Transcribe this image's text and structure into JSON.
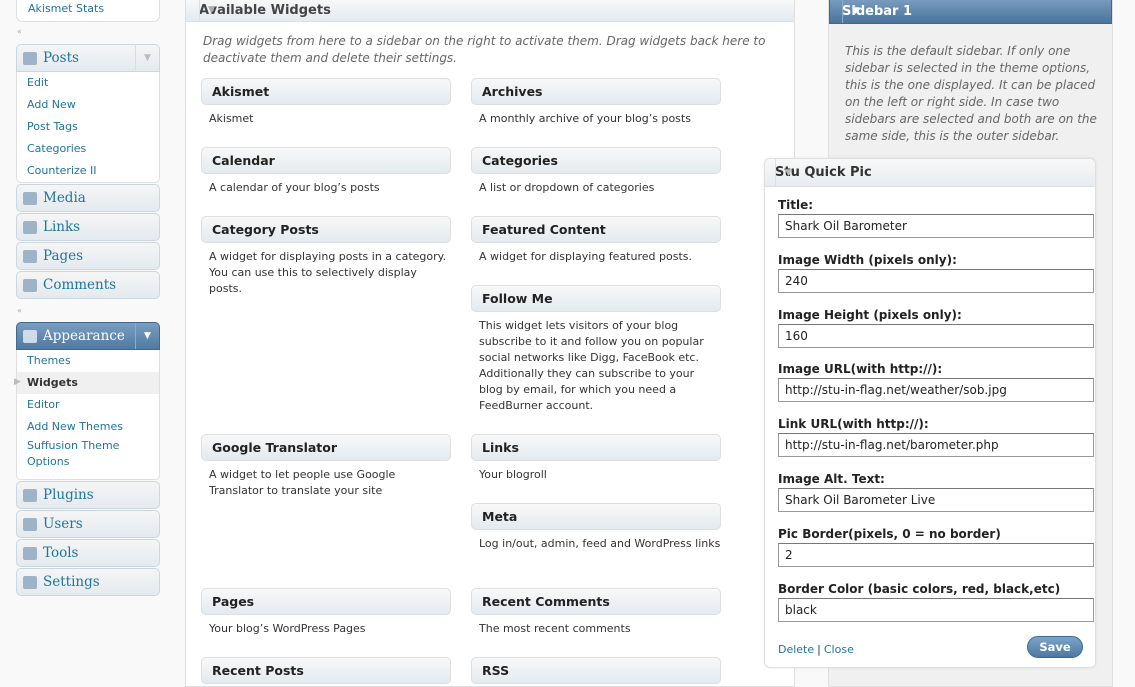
{
  "menu": {
    "akismet_stats": "Akismet Stats",
    "posts": {
      "label": "Posts",
      "items": [
        "Edit",
        "Add New",
        "Post Tags",
        "Categories",
        "Counterize II"
      ]
    },
    "media": "Media",
    "links": "Links",
    "pages": "Pages",
    "comments": "Comments",
    "appearance": {
      "label": "Appearance",
      "items": [
        "Themes",
        "Widgets",
        "Editor",
        "Add New Themes",
        "Suffusion Theme Options"
      ]
    },
    "plugins": "Plugins",
    "users": "Users",
    "tools": "Tools",
    "settings": "Settings"
  },
  "available": {
    "title": "Available Widgets",
    "description": "Drag widgets from here to a sidebar on the right to activate them. Drag widgets back here to deactivate them and delete their settings.",
    "widgets": [
      {
        "title": "Akismet",
        "desc": "Akismet"
      },
      {
        "title": "Archives",
        "desc": "A monthly archive of your blog’s posts"
      },
      {
        "title": "Calendar",
        "desc": "A calendar of your blog’s posts"
      },
      {
        "title": "Categories",
        "desc": "A list or dropdown of categories"
      },
      {
        "title": "Category Posts",
        "desc": "A widget for displaying posts in a category. You can use this to selectively display posts."
      },
      {
        "title": "Featured Content",
        "desc": "A widget for displaying featured posts."
      },
      {
        "title": "Follow Me",
        "desc": "This widget lets visitors of your blog subscribe to it and follow you on popular social networks like Digg, FaceBook etc. Additionally they can subscribe to your blog by email, for which you need a FeedBurner account."
      },
      {
        "title": "Google Translator",
        "desc": "A widget to let people use Google Translator to translate your site"
      },
      {
        "title": "Links",
        "desc": "Your blogroll"
      },
      {
        "title": "Meta",
        "desc": "Log in/out, admin, feed and WordPress links"
      },
      {
        "title": "Pages",
        "desc": "Your blog’s WordPress Pages"
      },
      {
        "title": "Recent Comments",
        "desc": "The most recent comments"
      },
      {
        "title": "Recent Posts",
        "desc": ""
      },
      {
        "title": "RSS",
        "desc": ""
      }
    ]
  },
  "sidebar": {
    "title": "Sidebar 1",
    "description": "This is the default sidebar. If only one sidebar is selected in the theme options, this is the one displayed. It can be placed on the left or right side. In case two sidebars are selected and both are on the same side, this is the outer sidebar."
  },
  "quickpic": {
    "title": "Stu Quick Pic",
    "fields": [
      {
        "label": "Title:",
        "value": "Shark Oil Barometer"
      },
      {
        "label": "Image Width (pixels only):",
        "value": "240"
      },
      {
        "label": "Image Height (pixels only):",
        "value": "160"
      },
      {
        "label": "Image URL(with http://):",
        "value": "http://stu-in-flag.net/weather/sob.jpg"
      },
      {
        "label": "Link URL(with http://):",
        "value": "http://stu-in-flag.net/barometer.php"
      },
      {
        "label": "Image Alt. Text:",
        "value": "Shark Oil Barometer Live"
      },
      {
        "label": "Pic Border(pixels, 0 = no border)",
        "value": "2"
      },
      {
        "label": "Border Color (basic colors, red, black,etc)",
        "value": "black"
      }
    ],
    "delete": "Delete",
    "separator": "|",
    "close": "Close",
    "save": "Save"
  }
}
